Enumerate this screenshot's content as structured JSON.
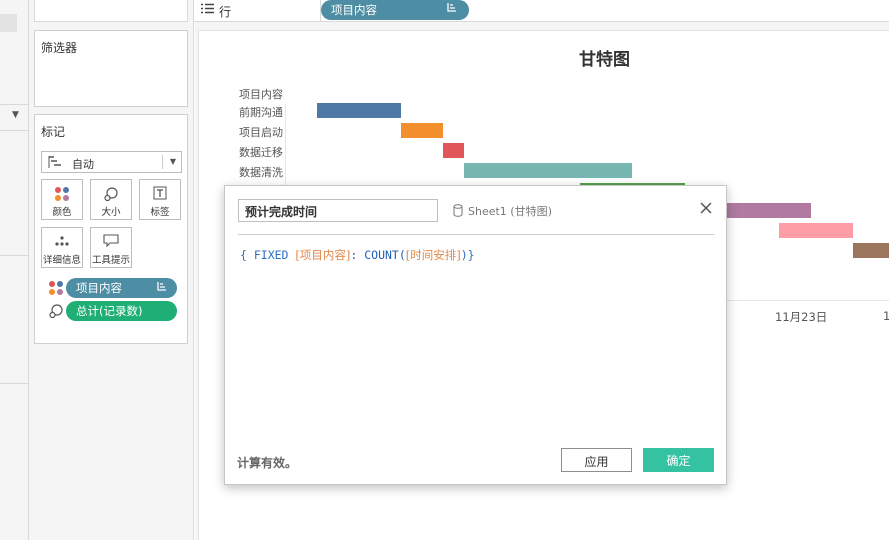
{
  "shelf": {
    "rows_label": "行",
    "rows_pill": "项目内容"
  },
  "filters": {
    "title": "筛选器"
  },
  "marks": {
    "title": "标记",
    "mark_type": "自动",
    "buttons": {
      "color": "颜色",
      "size": "大小",
      "label": "标签",
      "detail": "详细信息",
      "tooltip": "工具提示"
    },
    "pills": [
      {
        "label": "项目内容",
        "color": "#4e8ea4"
      },
      {
        "label": "总计(记录数)",
        "color": "#1fae74"
      }
    ]
  },
  "view": {
    "title": "甘特图",
    "header_label": "项目内容",
    "x_tick_1": "11月23日",
    "x_tick_2": "1"
  },
  "chart_data": {
    "type": "bar",
    "title": "甘特图",
    "categories": [
      "前期沟通",
      "项目启动",
      "数据迁移",
      "数据清洗",
      "",
      "",
      "",
      ""
    ],
    "series": [
      {
        "values": [
          1,
          1,
          1,
          1,
          1,
          1,
          1,
          1
        ]
      }
    ],
    "colors": [
      "#4e79a7",
      "#f28e2b",
      "#e15759",
      "#76b7b2",
      "#59a14f",
      "#b07aa1",
      "#ff9da7",
      "#9c755f"
    ],
    "xlabel": "",
    "ylabel": "项目内容",
    "x_tick_labels": [
      "11月23日",
      "1"
    ]
  },
  "dialog": {
    "name": "预计完成时间",
    "source_name": "Sheet1",
    "source_sheet": "(甘特图)",
    "formula": {
      "open": "{ FIXED ",
      "field1": "[项目内容]",
      "mid": ": COUNT(",
      "field2": "[时间安排]",
      "close": ")}"
    },
    "status": "计算有效。",
    "apply": "应用",
    "ok": "确定"
  }
}
